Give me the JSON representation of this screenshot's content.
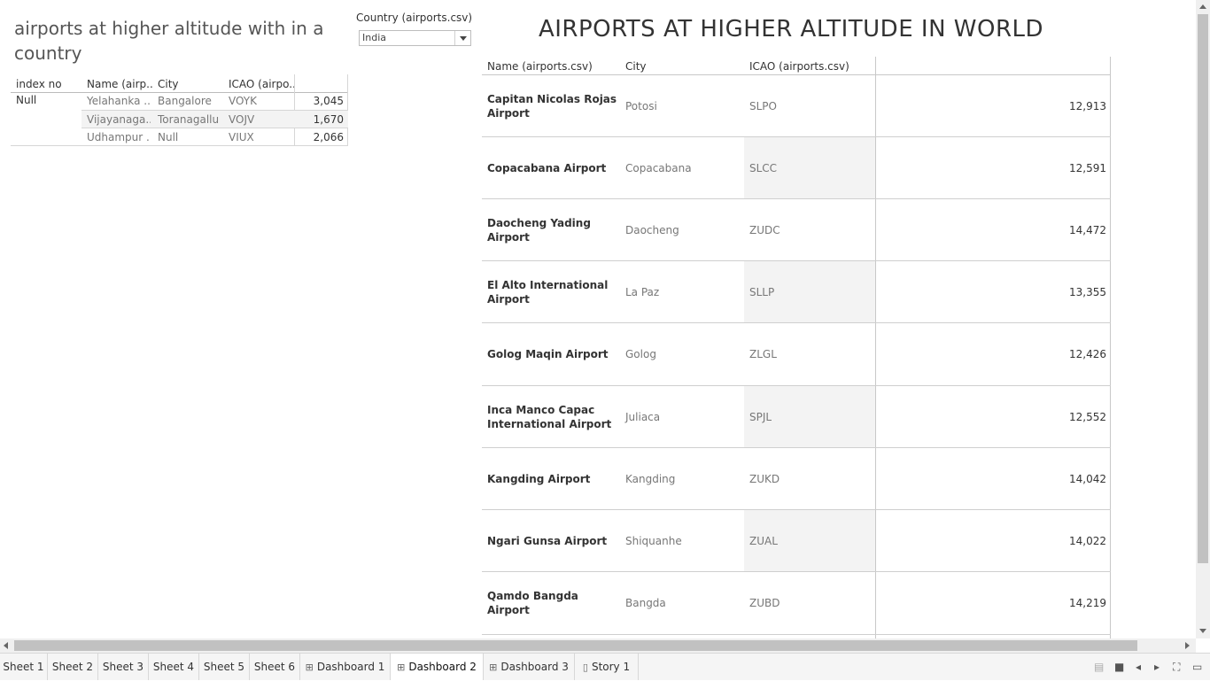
{
  "left_sheet": {
    "title": "airports at higher altitude with in a country",
    "headers": [
      "index no",
      "Name (airp..",
      "City",
      "ICAO (airpo.."
    ],
    "index_value": "Null",
    "rows": [
      {
        "name": "Yelahanka ..",
        "city": "Bangalore",
        "icao": "VOYK",
        "altitude": "3,045"
      },
      {
        "name": "Vijayanaga..",
        "city": "Toranagallu",
        "icao": "VOJV",
        "altitude": "1,670"
      },
      {
        "name": "Udhampur ..",
        "city": "Null",
        "icao": "VIUX",
        "altitude": "2,066"
      }
    ]
  },
  "filter": {
    "label": "Country (airports.csv)",
    "value": "India"
  },
  "right_sheet": {
    "title": "AIRPORTS AT HIGHER ALTITUDE IN WORLD",
    "headers": [
      "Name (airports.csv)",
      "City",
      "ICAO (airports.csv)"
    ],
    "rows": [
      {
        "name": "Capitan Nicolas Rojas Airport",
        "city": "Potosi",
        "icao": "SLPO",
        "altitude": "12,913"
      },
      {
        "name": "Copacabana Airport",
        "city": "Copacabana",
        "icao": "SLCC",
        "altitude": "12,591"
      },
      {
        "name": "Daocheng Yading Airport",
        "city": "Daocheng",
        "icao": "ZUDC",
        "altitude": "14,472"
      },
      {
        "name": "El Alto International Airport",
        "city": "La Paz",
        "icao": "SLLP",
        "altitude": "13,355"
      },
      {
        "name": "Golog Maqin Airport",
        "city": "Golog",
        "icao": "ZLGL",
        "altitude": "12,426"
      },
      {
        "name": "Inca Manco Capac International Airport",
        "city": "Juliaca",
        "icao": "SPJL",
        "altitude": "12,552"
      },
      {
        "name": "Kangding Airport",
        "city": "Kangding",
        "icao": "ZUKD",
        "altitude": "14,042"
      },
      {
        "name": "Ngari Gunsa Airport",
        "city": "Shiquanhe",
        "icao": "ZUAL",
        "altitude": "14,022"
      },
      {
        "name": "Qamdo Bangda Airport",
        "city": "Bangda",
        "icao": "ZUBD",
        "altitude": "14,219"
      }
    ]
  },
  "tabs": [
    {
      "label": "Sheet 1",
      "icon": ""
    },
    {
      "label": "Sheet 2",
      "icon": ""
    },
    {
      "label": "Sheet 3",
      "icon": ""
    },
    {
      "label": "Sheet 4",
      "icon": ""
    },
    {
      "label": "Sheet 5",
      "icon": ""
    },
    {
      "label": "Sheet 6",
      "icon": ""
    },
    {
      "label": "Dashboard 1",
      "icon": "dashboard-icon"
    },
    {
      "label": "Dashboard 2",
      "icon": "dashboard-icon",
      "active": true
    },
    {
      "label": "Dashboard 3",
      "icon": "dashboard-icon"
    },
    {
      "label": "Story 1",
      "icon": "story-icon"
    }
  ],
  "toolbar_icons": [
    "sheet-sorter-icon",
    "filmstrip-icon",
    "previous-icon",
    "next-icon",
    "fullscreen-icon",
    "presentation-icon"
  ]
}
